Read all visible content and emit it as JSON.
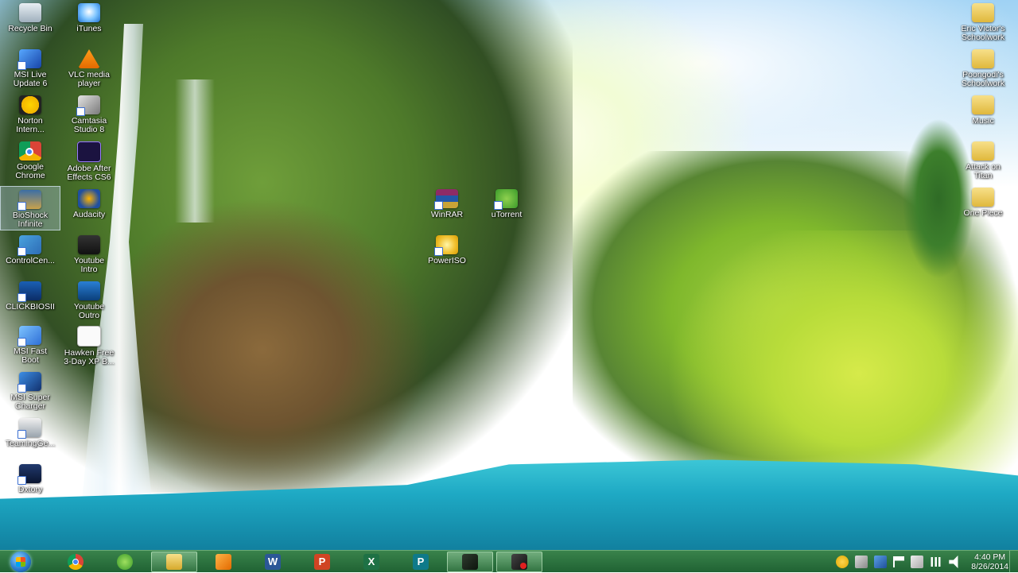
{
  "desktop": {
    "icons_left_col1": [
      {
        "label": "Recycle Bin",
        "icon": "recycle-bin-icon"
      },
      {
        "label": "MSI Live\nUpdate 6",
        "icon": "msi-live-update-icon"
      },
      {
        "label": "Norton\nIntern...",
        "icon": "norton-icon"
      },
      {
        "label": "Google\nChrome",
        "icon": "chrome-icon"
      },
      {
        "label": "BioShock\nInfinite",
        "icon": "bioshock-icon"
      },
      {
        "label": "ControlCen...",
        "icon": "control-center-icon"
      },
      {
        "label": "CLICKBIOSII",
        "icon": "clickbios-icon"
      },
      {
        "label": "MSI Fast\nBoot",
        "icon": "msi-fast-boot-icon"
      },
      {
        "label": "MSI Super\nCharger",
        "icon": "msi-super-charger-icon"
      },
      {
        "label": "TeamingGe...",
        "icon": "teaming-icon"
      },
      {
        "label": "Dxtory",
        "icon": "dxtory-icon"
      }
    ],
    "icons_left_col2": [
      {
        "label": "iTunes",
        "icon": "itunes-icon"
      },
      {
        "label": "VLC media\nplayer",
        "icon": "vlc-icon"
      },
      {
        "label": "Camtasia\nStudio 8",
        "icon": "camtasia-icon"
      },
      {
        "label": "Adobe After\nEffects CS6",
        "icon": "after-effects-icon"
      },
      {
        "label": "Audacity",
        "icon": "audacity-icon"
      },
      {
        "label": "Youtube\nIntro",
        "icon": "youtube-intro-icon"
      },
      {
        "label": "Youtube\nOutro",
        "icon": "youtube-outro-icon"
      },
      {
        "label": "Hawken Free\n3-Day XP B...",
        "icon": "text-file-icon"
      }
    ],
    "icons_center": [
      {
        "label": "WinRAR",
        "icon": "winrar-icon"
      },
      {
        "label": "uTorrent",
        "icon": "utorrent-icon"
      },
      {
        "label": "PowerISO",
        "icon": "poweriso-icon"
      }
    ],
    "icons_right": [
      {
        "label": "Eric Victor's\nSchoolwork",
        "icon": "folder-icon"
      },
      {
        "label": "Poongodi's\nSchoolwork",
        "icon": "folder-icon"
      },
      {
        "label": "Music",
        "icon": "folder-icon"
      },
      {
        "label": "Attack on\nTitan",
        "icon": "folder-icon"
      },
      {
        "label": "One Piece",
        "icon": "folder-icon"
      }
    ]
  },
  "taskbar": {
    "start": "start-orb-icon",
    "buttons": [
      {
        "name": "chrome",
        "icon": "chrome-icon",
        "glyph": ""
      },
      {
        "name": "utorrent",
        "icon": "utorrent-icon",
        "glyph": ""
      },
      {
        "name": "explorer",
        "icon": "folder-icon",
        "glyph": ""
      },
      {
        "name": "media-player",
        "icon": "media-player-icon",
        "glyph": ""
      },
      {
        "name": "word",
        "icon": "word-icon",
        "glyph": "W"
      },
      {
        "name": "powerpoint",
        "icon": "powerpoint-icon",
        "glyph": "P"
      },
      {
        "name": "excel",
        "icon": "excel-icon",
        "glyph": "X"
      },
      {
        "name": "publisher",
        "icon": "publisher-icon",
        "glyph": "P"
      },
      {
        "name": "app-1",
        "icon": "app-icon",
        "glyph": ""
      },
      {
        "name": "app-2",
        "icon": "app-icon",
        "glyph": ""
      }
    ],
    "clock": {
      "time": "4:40 PM",
      "date": "8/26/2014"
    }
  }
}
